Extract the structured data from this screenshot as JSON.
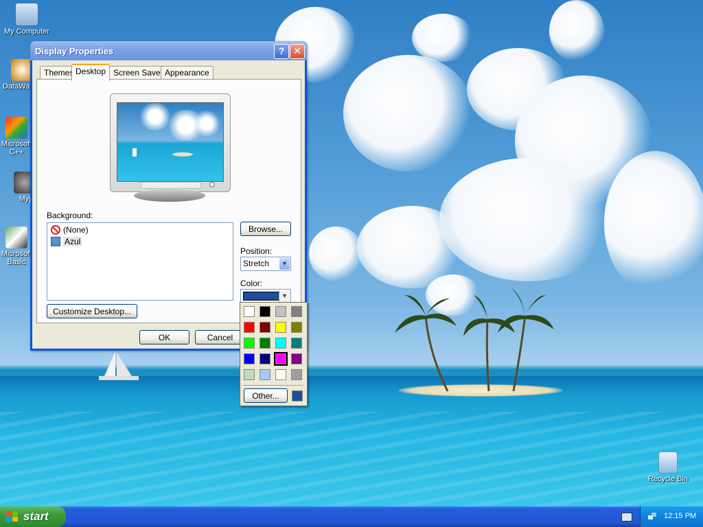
{
  "desktop": {
    "icons": [
      {
        "label": "My Computer"
      },
      {
        "label": "DataWa"
      },
      {
        "label": "Microsoft C++"
      },
      {
        "label": "Myp"
      },
      {
        "label": "Microsoft Basic"
      },
      {
        "label": "Recycle Bin"
      }
    ]
  },
  "dialog": {
    "title": "Display Properties",
    "help_glyph": "?",
    "close_glyph": "✕",
    "tabs": [
      {
        "label": "Themes"
      },
      {
        "label": "Desktop",
        "active": true
      },
      {
        "label": "Screen Saver"
      },
      {
        "label": "Appearance"
      }
    ],
    "background_label": "Background:",
    "background_items": [
      {
        "label": "(None)",
        "icon": "no-entry-icon"
      },
      {
        "label": "Azul",
        "icon": "image-file-icon",
        "selected": true
      }
    ],
    "browse_label": "Browse...",
    "position_label": "Position:",
    "position_value": "Stretch",
    "color_label": "Color:",
    "color_value": "#1e4e9c",
    "customize_label": "Customize Desktop...",
    "ok_label": "OK",
    "cancel_label": "Cancel"
  },
  "color_palette": {
    "colors": [
      "#ffffff",
      "#000000",
      "#c0c0c0",
      "#808080",
      "#ff0000",
      "#800000",
      "#ffff00",
      "#808000",
      "#00ff00",
      "#008000",
      "#00ffff",
      "#008080",
      "#0000ff",
      "#000080",
      "#ff00ff",
      "#800080",
      "#c0dcc0",
      "#a6caf0",
      "#fffbf0",
      "#a0a0a4"
    ],
    "selected_color": "#ff00ff",
    "other_label": "Other...",
    "custom_color": "#1e4e9c"
  },
  "taskbar": {
    "start_label": "start",
    "clock": "12:15 PM"
  }
}
